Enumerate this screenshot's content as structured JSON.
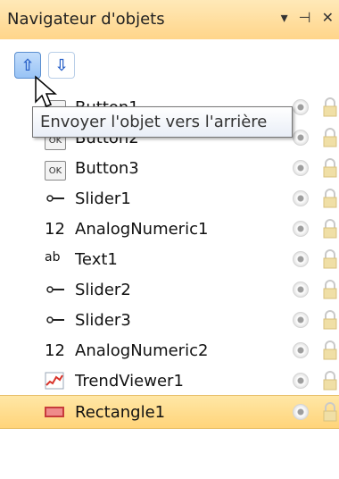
{
  "panel": {
    "title": "Navigateur d'objets",
    "pin_icon": "pin-icon",
    "dropdown_icon": "dropdown-icon",
    "close_icon": "close-icon"
  },
  "toolbar": {
    "buttons": [
      {
        "name": "bring-forward",
        "icon": "arrow-up-icon"
      },
      {
        "name": "send-backward",
        "icon": "arrow-down-icon"
      }
    ]
  },
  "tooltip": {
    "text": "Envoyer l'objet vers l'arrière"
  },
  "objects": [
    {
      "label": "Button1",
      "icon": "button-ok-icon"
    },
    {
      "label": "Button2",
      "icon": "button-ok-icon"
    },
    {
      "label": "Button3",
      "icon": "button-ok-icon"
    },
    {
      "label": "Slider1",
      "icon": "slider-icon"
    },
    {
      "label": "AnalogNumeric1",
      "icon": "analog-numeric-icon"
    },
    {
      "label": "Text1",
      "icon": "text-icon"
    },
    {
      "label": "Slider2",
      "icon": "slider-icon"
    },
    {
      "label": "Slider3",
      "icon": "slider-icon"
    },
    {
      "label": "AnalogNumeric2",
      "icon": "analog-numeric-icon"
    },
    {
      "label": "TrendViewer1",
      "icon": "trend-viewer-icon"
    },
    {
      "label": "Rectangle1",
      "icon": "rectangle-icon",
      "selected": true
    }
  ],
  "icon_text": {
    "ok": "OK",
    "num": "12",
    "ab": "ab"
  }
}
